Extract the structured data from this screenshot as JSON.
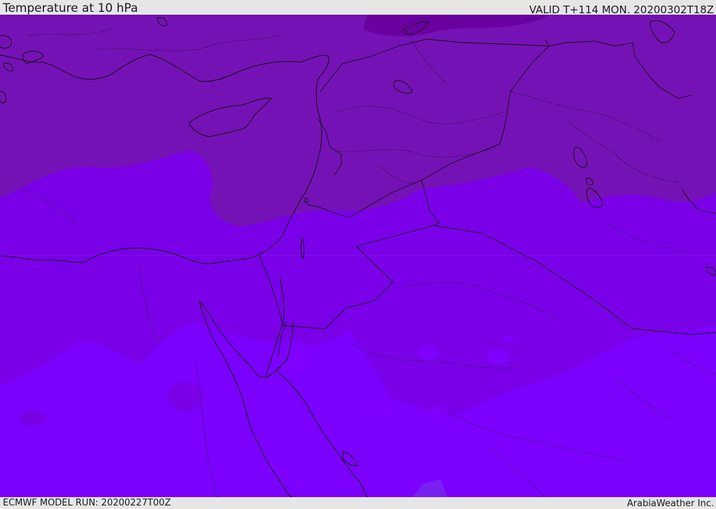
{
  "header": {
    "title": "Temperature at 10 hPa",
    "valid": "VALID T+114 MON. 20200302T18Z"
  },
  "footer": {
    "model_run": "ECMWF MODEL RUN: 20200227T00Z",
    "credit": "ArabiaWeather Inc."
  },
  "map": {
    "field": "Temperature at 10 hPa",
    "colors": {
      "band_coldest": "#6a00a0",
      "band_cold": "#7a12b4",
      "band_mid": "#7d00e6",
      "band_warm": "#7b00f8",
      "band_warmest": "#7f00ff",
      "coastline": "#101010"
    }
  }
}
